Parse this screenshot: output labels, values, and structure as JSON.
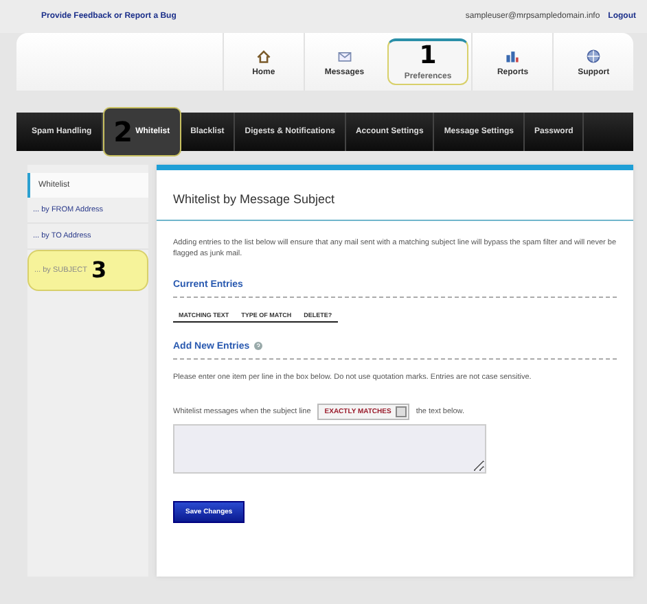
{
  "top_bar": {
    "feedback_link": "Provide Feedback or Report a Bug",
    "user_email": "sampleuser@mrpsampledomain.info",
    "logout_link": "Logout"
  },
  "main_nav": [
    {
      "label": "Home",
      "selected": false
    },
    {
      "label": "Messages",
      "selected": false
    },
    {
      "label": "Preferences",
      "selected": true,
      "callout": "1"
    },
    {
      "label": "Reports",
      "selected": false
    },
    {
      "label": "Support",
      "selected": false
    }
  ],
  "sub_nav": [
    {
      "label": "Spam Handling",
      "selected": false
    },
    {
      "label": "Whitelist",
      "selected": true,
      "callout": "2"
    },
    {
      "label": "Blacklist",
      "selected": false
    },
    {
      "label": "Digests & Notifications",
      "selected": false
    },
    {
      "label": "Account Settings",
      "selected": false
    },
    {
      "label": "Message Settings",
      "selected": false
    },
    {
      "label": "Password",
      "selected": false
    }
  ],
  "sidebar": {
    "heading": "Whitelist",
    "items": [
      {
        "label": "... by FROM Address",
        "selected": false
      },
      {
        "label": "... by TO Address",
        "selected": false
      },
      {
        "label": "... by SUBJECT",
        "selected": true,
        "callout": "3"
      }
    ]
  },
  "panel": {
    "title": "Whitelist by Message Subject",
    "intro": "Adding entries to the list below will ensure that any mail sent with a matching subject line will bypass the spam filter and will never be flagged as junk mail.",
    "current_heading": "Current Entries",
    "columns": [
      "MATCHING TEXT",
      "TYPE OF MATCH",
      "DELETE?"
    ],
    "add_heading": "Add New Entries",
    "instructions": "Please enter one item per line in the box below. Do not use quotation marks. Entries are not case sensitive.",
    "match_prefix": "Whitelist messages when the subject line",
    "match_type": "EXACTLY MATCHES",
    "match_suffix": "the text below.",
    "save_button": "Save Changes"
  }
}
